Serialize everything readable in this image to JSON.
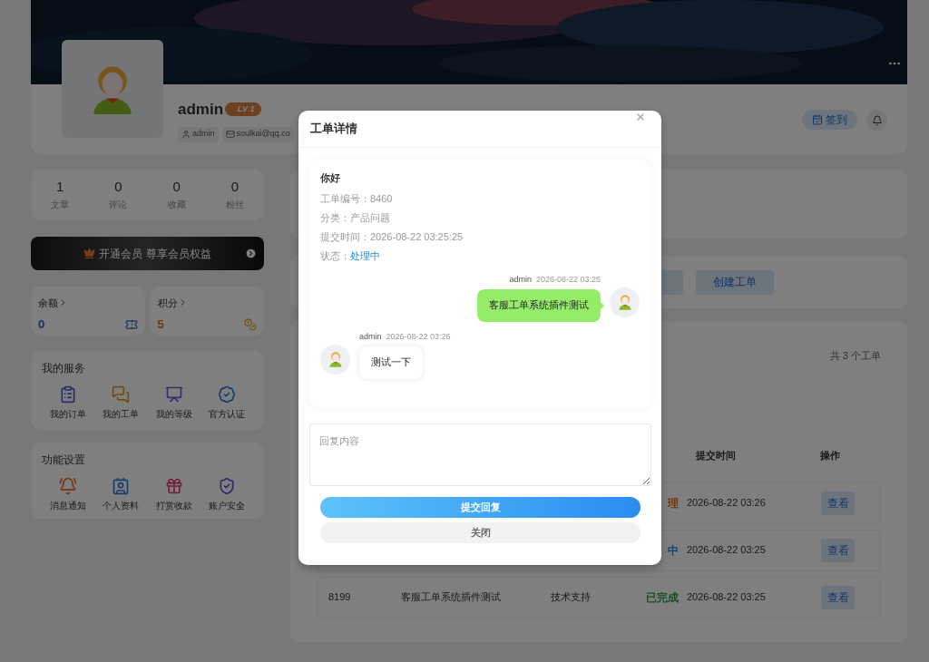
{
  "profile": {
    "name": "admin",
    "level": "LV 1",
    "tags": [
      {
        "kind": "user",
        "text": "admin"
      },
      {
        "kind": "email",
        "text": "soulkai@qq.co"
      }
    ],
    "sign_in": "签到"
  },
  "stats": [
    {
      "value": "1",
      "label": "文章"
    },
    {
      "value": "0",
      "label": "评论"
    },
    {
      "value": "0",
      "label": "收藏"
    },
    {
      "value": "0",
      "label": "粉丝"
    }
  ],
  "vip_banner": "开通会员 尊享会员权益",
  "wallets": [
    {
      "kind": "balance",
      "label": "余额",
      "value": "0"
    },
    {
      "kind": "points",
      "label": "积分",
      "value": "5"
    }
  ],
  "services": {
    "title": "我的服务",
    "items": [
      {
        "kind": "orders",
        "label": "我的订单"
      },
      {
        "kind": "tickets",
        "label": "我的工单"
      },
      {
        "kind": "level",
        "label": "我的等级"
      },
      {
        "kind": "verify",
        "label": "官方认证"
      }
    ]
  },
  "settings": {
    "title": "功能设置",
    "items": [
      {
        "kind": "notify",
        "label": "消息通知"
      },
      {
        "kind": "profile",
        "label": "个人资料"
      },
      {
        "kind": "reward",
        "label": "打赏收款"
      },
      {
        "kind": "security",
        "label": "账户安全"
      }
    ]
  },
  "tickets": {
    "create_button": "创建工单",
    "count": "共 3 个工单",
    "columns": [
      "提交时间",
      "操作"
    ],
    "rows": [
      {
        "status": "理",
        "color": "#703508",
        "time": "2026-08-22 03:26",
        "action": "查看"
      },
      {
        "status": "中",
        "color": "#0f4472",
        "time": "2026-08-22 03:25",
        "action": "查看"
      },
      {
        "id": "8199",
        "title": "客服工单系统插件测试",
        "category": "技术支持",
        "status": "已完成",
        "color": "#155024",
        "time": "2026-08-22 03:25",
        "action": "查看"
      }
    ]
  },
  "modal": {
    "title": "工单详情",
    "greeting": "你好",
    "fields": [
      {
        "label": "工单编号：",
        "value": "8460",
        "kind": "plain"
      },
      {
        "label": "分类：",
        "value": "产品问题",
        "kind": "plain"
      },
      {
        "label": "提交时间：",
        "value": "2026-08-22 03:25:25",
        "kind": "plain"
      },
      {
        "label": "状态：",
        "value": "处理中",
        "kind": "status"
      }
    ],
    "messages": [
      {
        "kind": "sent",
        "author": "admin",
        "time": "2026-08-22 03:25",
        "text": "客服工单系统插件测试"
      },
      {
        "kind": "received",
        "author": "admin",
        "time": "2026-08-22 03:26",
        "text": "测试一下"
      }
    ],
    "reply": {
      "placeholder": "回复内容"
    },
    "submit": "提交回复",
    "close_button": "关闭"
  }
}
